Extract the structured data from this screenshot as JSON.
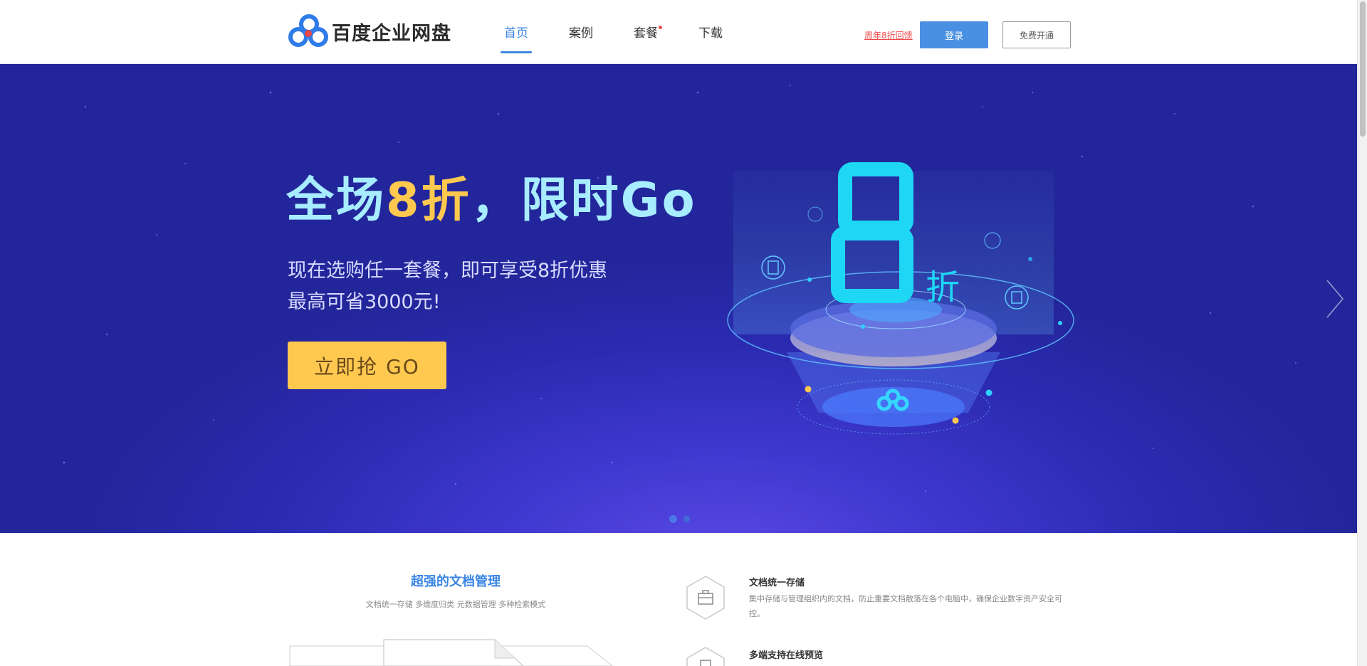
{
  "header": {
    "brand": "百度企业网盘",
    "nav": [
      {
        "label": "首页",
        "active": true
      },
      {
        "label": "案例",
        "active": false
      },
      {
        "label": "套餐",
        "active": false,
        "badge_dot": true
      },
      {
        "label": "下载",
        "active": false
      }
    ],
    "promo_link": "周年8折回馈",
    "login_label": "登录",
    "open_label": "免费开通"
  },
  "banner": {
    "title_part1": "全场",
    "title_highlight": "8折",
    "title_part2": "，限时Go",
    "subtitle_line1": "现在选购任一套餐，即可享受8折优惠",
    "subtitle_line2": "最高可省3000元!",
    "cta_label": "立即抢 GO",
    "illustration_big": "8",
    "illustration_small": "折",
    "slide_count": 2,
    "active_slide": 1
  },
  "features": {
    "section_title": "超强的文档管理",
    "section_subtitle": "文档统一存储 多维度归类 元数据管理 多种检索模式",
    "items": [
      {
        "name": "文档统一存储",
        "desc": "集中存储与管理组织内的文档，防止重要文档散落在各个电脑中，确保企业数字资产安全可控。",
        "icon": "briefcase-icon"
      },
      {
        "name": "多端支持在线预览",
        "desc": "",
        "icon": "document-icon"
      }
    ]
  },
  "colors": {
    "accent": "#3b86e4",
    "promo": "#f04b4b",
    "banner_bg": "#2b2bb2",
    "cta": "#ffc94f",
    "title_light": "#a7ecff"
  }
}
